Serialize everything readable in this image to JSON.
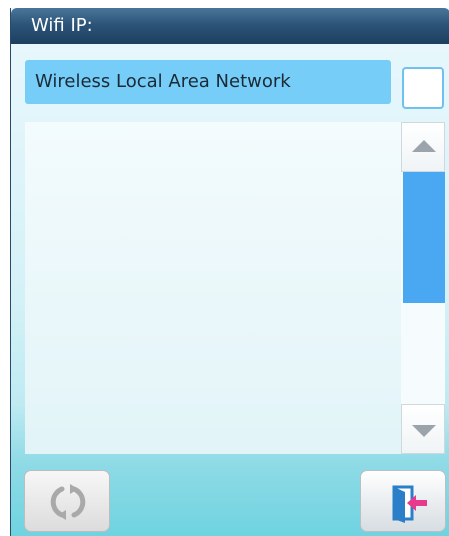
{
  "window": {
    "title": "Wifi IP:"
  },
  "network": {
    "selected_label": "Wireless Local Area Network",
    "checked": false
  },
  "list": {
    "items": [],
    "scroll_position": 0.0
  },
  "toolbar": {
    "refresh_icon": "refresh-icon",
    "exit_icon": "exit-door-icon"
  },
  "colors": {
    "titlebar": "#2c5479",
    "selection": "#75cdf8",
    "scroll_thumb": "#4aa8f2",
    "exit_arrow": "#e83a8c",
    "exit_door": "#2a7fc8"
  }
}
